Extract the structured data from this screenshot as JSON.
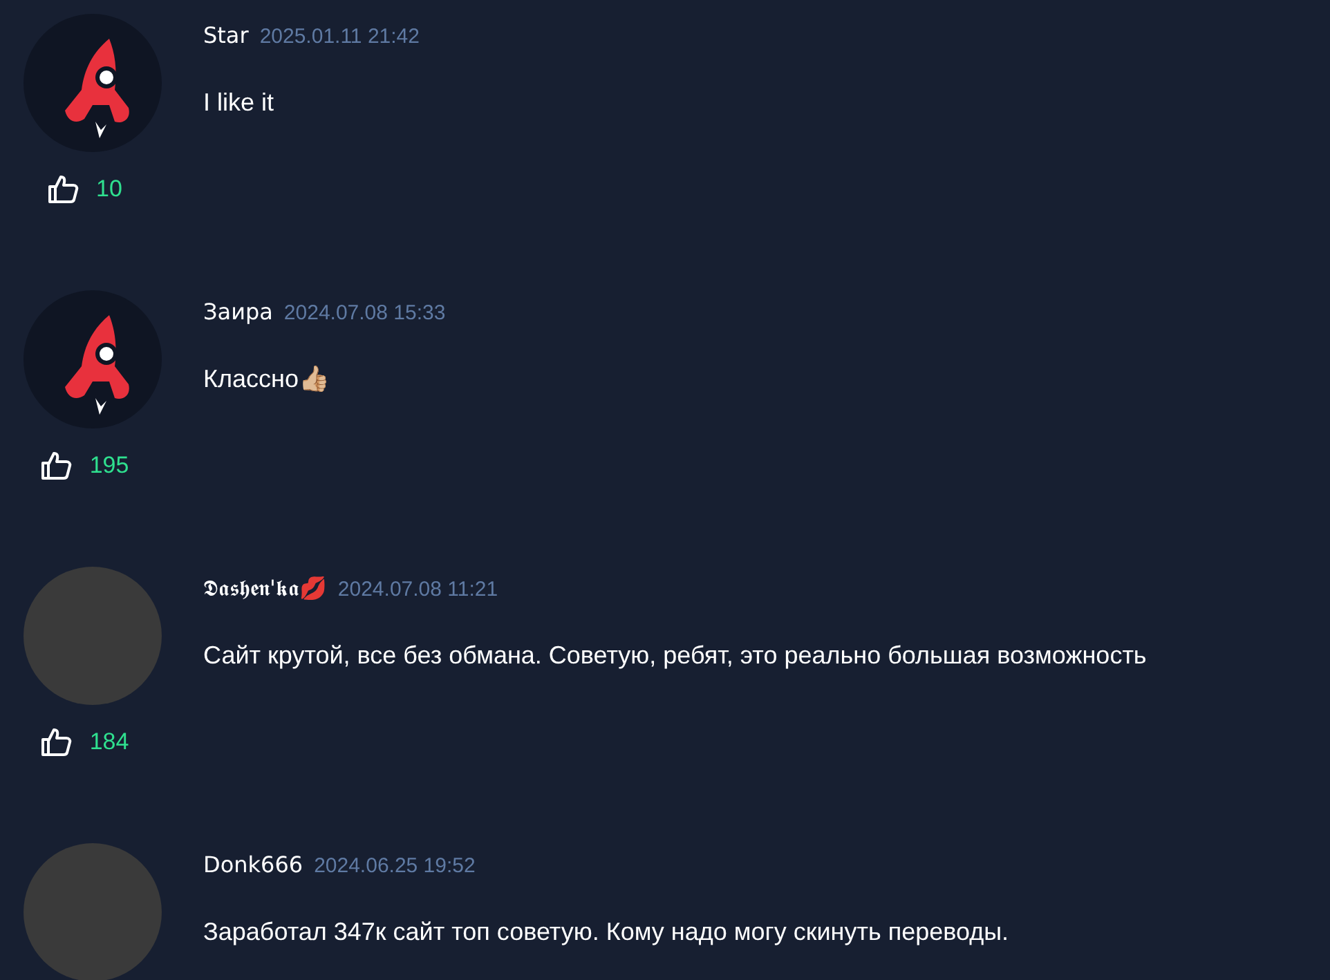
{
  "comments": [
    {
      "avatar": {
        "kind": "logo"
      },
      "author": "Star",
      "date": "2025.01.11 21:42",
      "text": "I like it",
      "likes": "10"
    },
    {
      "avatar": {
        "kind": "logo"
      },
      "author": "Заира",
      "date": "2024.07.08 15:33",
      "text": "Классно👍🏼",
      "likes": "195"
    },
    {
      "avatar": {
        "kind": "photo"
      },
      "author": "𝕯𝖆𝖘𝖍𝖊𝖓'𝖐𝖆💋",
      "date": "2024.07.08 11:21",
      "text": "Сайт крутой, все без обмана. Советую, ребят, это реально большая возможность",
      "likes": "184"
    },
    {
      "avatar": {
        "kind": "photo"
      },
      "author": "Donk666",
      "date": "2024.06.25 19:52",
      "text": "Заработал 347к сайт топ советую. Кому надо могу скинуть переводы."
    }
  ]
}
